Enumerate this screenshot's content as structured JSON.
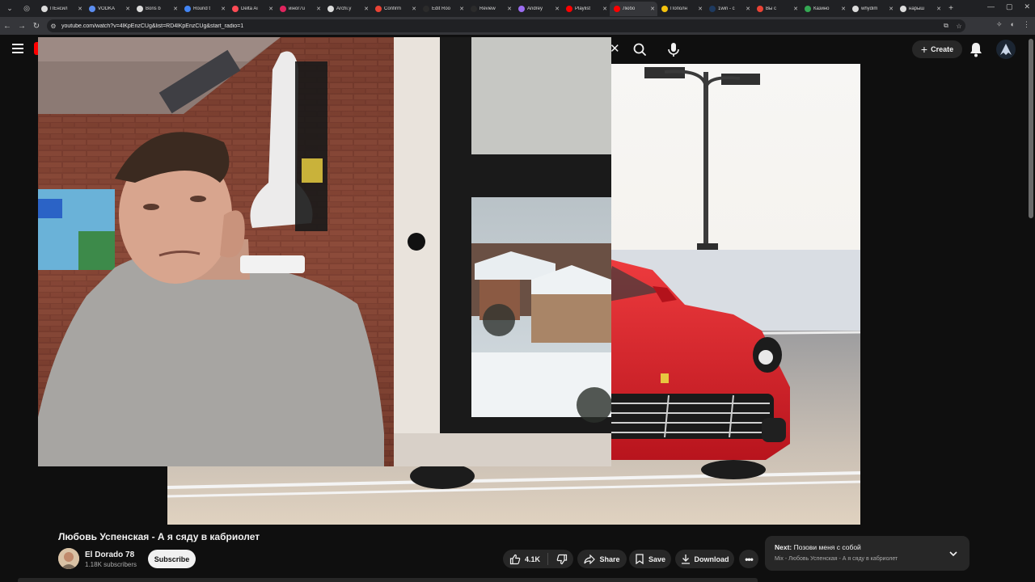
{
  "browser": {
    "tabs": [
      {
        "title": "ПЕнсил",
        "color": "#dcdcdc"
      },
      {
        "title": "VODKA",
        "color": "#5b8def"
      },
      {
        "title": "Boris b",
        "color": "#dcdcdc"
      },
      {
        "title": "Round t",
        "color": "#4285f4"
      },
      {
        "title": "Delta Ai",
        "color": "#ff4b55"
      },
      {
        "title": "иiнor7u",
        "color": "#e0245e"
      },
      {
        "title": "Archi.y",
        "color": "#dcdcdc"
      },
      {
        "title": "Confirm",
        "color": "#ea4335"
      },
      {
        "title": "Edit Roo",
        "color": "#2b2b2b"
      },
      {
        "title": "Review",
        "color": "#2b2b2b"
      },
      {
        "title": "Andrey",
        "color": "#9b6cf0"
      },
      {
        "title": "Playlist",
        "color": "#ff0000"
      },
      {
        "title": "Любо",
        "color": "#ff0000",
        "active": true
      },
      {
        "title": "Пополн",
        "color": "#f4c20d"
      },
      {
        "title": "1win - c",
        "color": "#1e3a5f"
      },
      {
        "title": "Вы с",
        "color": "#ea4335"
      },
      {
        "title": "Казино",
        "color": "#34a853"
      },
      {
        "title": "whydim",
        "color": "#dcdcdc"
      },
      {
        "title": "нарыш",
        "color": "#dcdcdc"
      }
    ],
    "url": "youtube.com/watch?v=4lKpEnzCUg&list=RD4lKpEnzCUg&start_radio=1"
  },
  "header": {
    "create_label": "Create"
  },
  "video": {
    "title": "Любовь Успенская - А я сяду в кабриолет",
    "channel_name": "El Dorado 78",
    "subscribers": "1.18K subscribers",
    "subscribe_label": "Subscribe",
    "likes": "4.1K",
    "share_label": "Share",
    "save_label": "Save",
    "download_label": "Download"
  },
  "next": {
    "prefix": "Next:",
    "title": "Позови меня с собой",
    "subtitle": "Mix - Любовь Успенская - А я сяду в кабриолет"
  },
  "colors": {
    "background": "#0f0f0f",
    "pill": "#272727",
    "brand_red": "#ff0000",
    "car_red": "#d81f2a"
  },
  "icons": [
    "menu-icon",
    "close-icon",
    "search-icon",
    "mic-icon",
    "bell-icon",
    "like-icon",
    "dislike-icon",
    "share-icon",
    "save-icon",
    "download-icon",
    "more-icon",
    "chevron-down-icon"
  ]
}
